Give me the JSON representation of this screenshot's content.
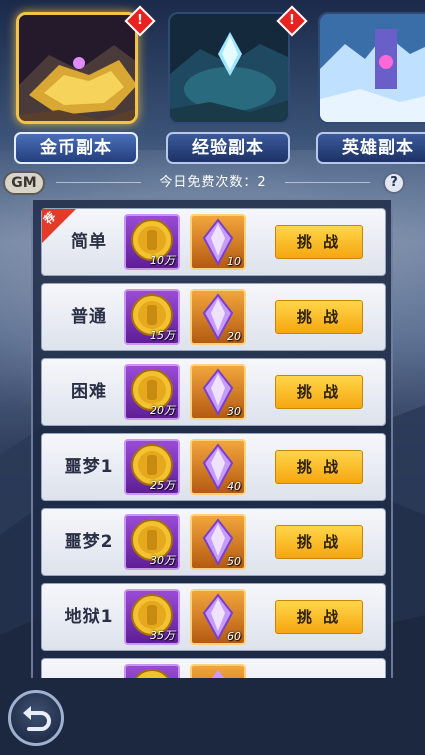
{
  "tabs": [
    {
      "label": "金币副本",
      "alert": "!",
      "active": true
    },
    {
      "label": "经验副本",
      "alert": "!",
      "active": false
    },
    {
      "label": "英雄副本",
      "alert": "",
      "active": false
    }
  ],
  "gm_label": "GM",
  "free_attempts": "今日免费次数：2",
  "help_label": "?",
  "recommend_tag": "荐",
  "levels": [
    {
      "name": "简单",
      "coin": "10万",
      "gem": "10",
      "button": "挑 战"
    },
    {
      "name": "普通",
      "coin": "15万",
      "gem": "20",
      "button": "挑 战"
    },
    {
      "name": "困难",
      "coin": "20万",
      "gem": "30",
      "button": "挑 战"
    },
    {
      "name": "噩梦1",
      "coin": "25万",
      "gem": "40",
      "button": "挑 战"
    },
    {
      "name": "噩梦2",
      "coin": "30万",
      "gem": "50",
      "button": "挑 战"
    },
    {
      "name": "地狱1",
      "coin": "35万",
      "gem": "60",
      "button": "挑 战"
    }
  ],
  "icons": {
    "coin": "gold-coin-icon",
    "gem": "purple-crystal-icon",
    "back": "return-arrow-icon"
  }
}
